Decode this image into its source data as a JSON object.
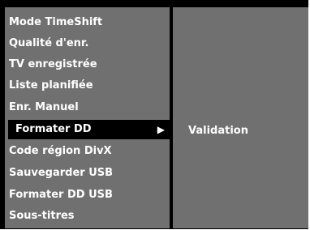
{
  "menu": {
    "items": [
      {
        "label": "Mode TimeShift"
      },
      {
        "label": "Qualité d'enr."
      },
      {
        "label": "TV enregistrée"
      },
      {
        "label": "Liste planifiée"
      },
      {
        "label": "Enr. Manuel"
      },
      {
        "label": "Formater DD",
        "selected": true,
        "has_submenu": true
      },
      {
        "label": "Code région DivX"
      },
      {
        "label": "Sauvegarder USB"
      },
      {
        "label": "Formater DD USB"
      },
      {
        "label": "Sous-titres"
      }
    ],
    "submenu_arrow_icon": "right-triangle-icon",
    "submenu_arrow_glyph": "▶"
  },
  "submenu": {
    "items": [
      {
        "label": "Validation"
      }
    ]
  },
  "colors": {
    "panel": "#707070",
    "selection": "#000000",
    "text": "#ffffff",
    "frame": "#000000"
  }
}
